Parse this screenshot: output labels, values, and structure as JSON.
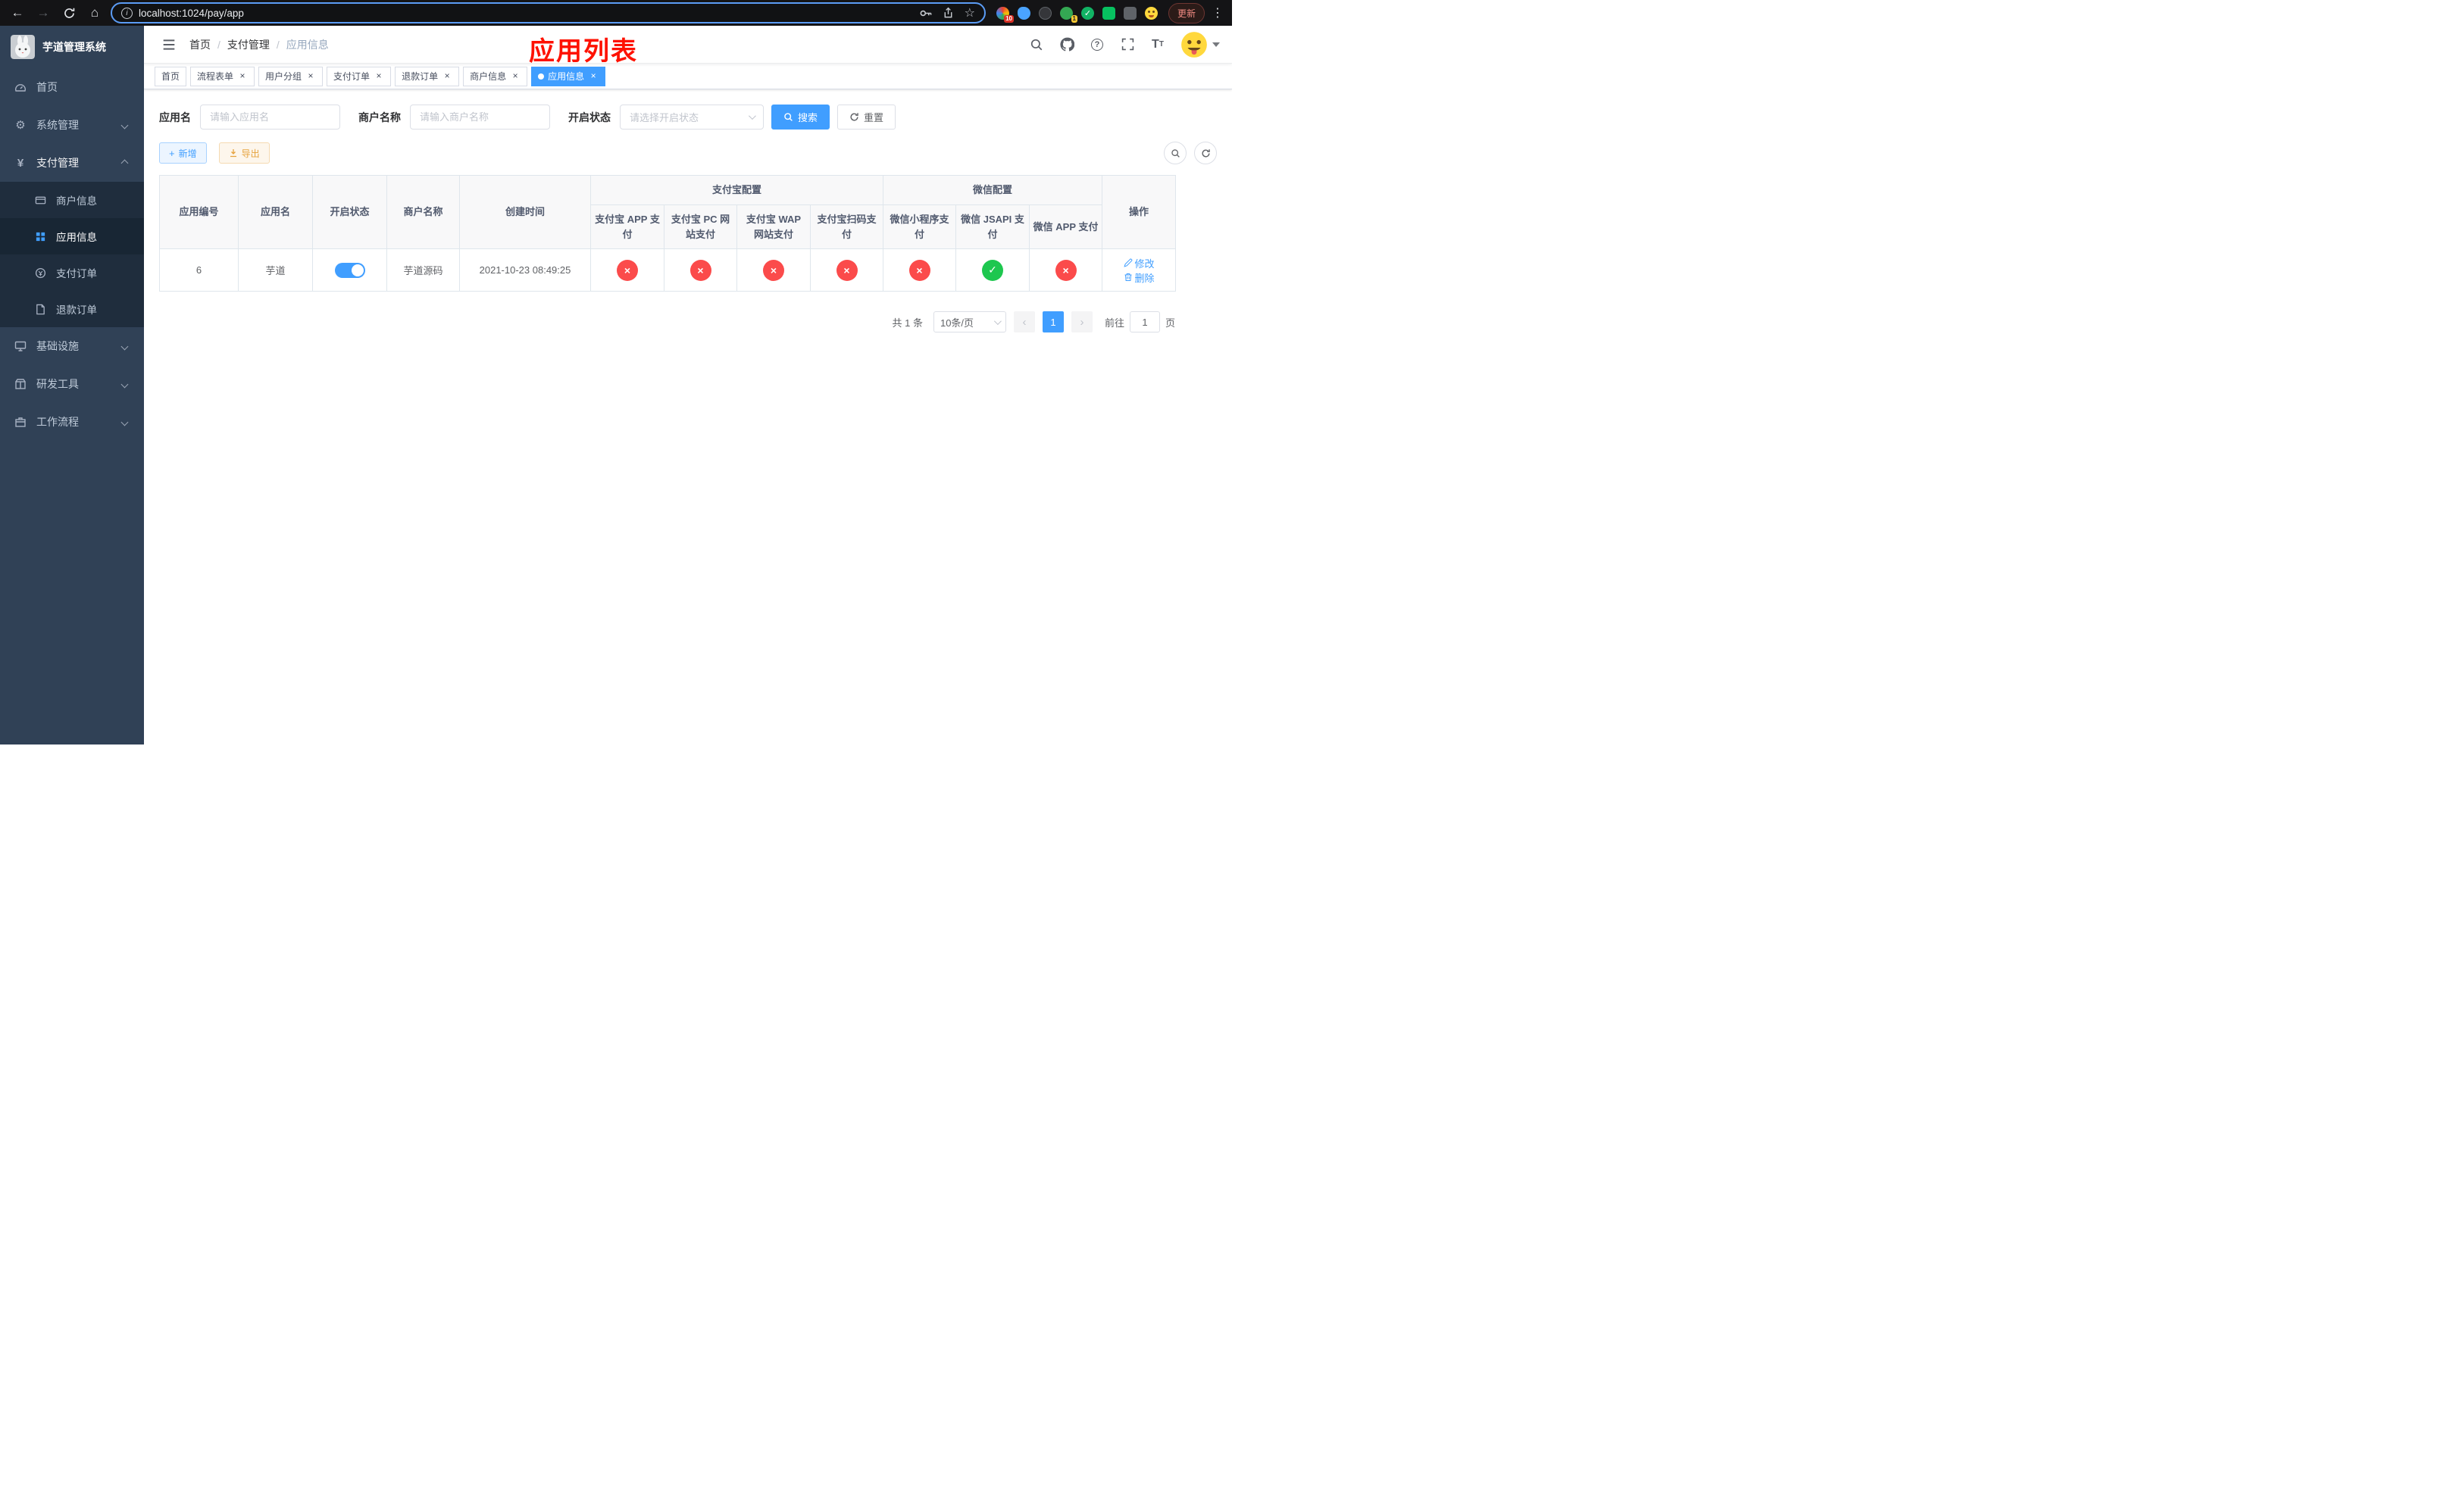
{
  "colors": {
    "primary": "#409eff",
    "success": "#1ec74f",
    "danger": "#fb4b4b",
    "warning": "#e6a23c",
    "annotation_red": "#fe1100"
  },
  "browser": {
    "url": "localhost:1024/pay/app",
    "update_label": "更新",
    "extension_badges": {
      "puzzle": "10",
      "translate": "1"
    }
  },
  "sidebar": {
    "app_title": "芋道管理系统",
    "menu": [
      {
        "label": "首页"
      },
      {
        "label": "系统管理"
      },
      {
        "label": "支付管理"
      },
      {
        "label": "基础设施"
      },
      {
        "label": "研发工具"
      },
      {
        "label": "工作流程"
      }
    ],
    "payment_submenu": [
      {
        "label": "商户信息"
      },
      {
        "label": "应用信息"
      },
      {
        "label": "支付订单"
      },
      {
        "label": "退款订单"
      }
    ]
  },
  "header": {
    "breadcrumb": [
      "首页",
      "支付管理",
      "应用信息"
    ],
    "annotation_title": "应用列表"
  },
  "tabs": [
    {
      "label": "首页"
    },
    {
      "label": "流程表单"
    },
    {
      "label": "用户分组"
    },
    {
      "label": "支付订单"
    },
    {
      "label": "退款订单"
    },
    {
      "label": "商户信息"
    },
    {
      "label": "应用信息"
    }
  ],
  "filters": {
    "app_name": {
      "label": "应用名",
      "placeholder": "请输入应用名",
      "value": ""
    },
    "merchant_name": {
      "label": "商户名称",
      "placeholder": "请输入商户名称",
      "value": ""
    },
    "status": {
      "label": "开启状态",
      "placeholder": "请选择开启状态"
    },
    "search_button": "搜索",
    "reset_button": "重置"
  },
  "toolbar": {
    "add_button": "新增",
    "export_button": "导出"
  },
  "table": {
    "groups": {
      "alipay": "支付宝配置",
      "wechat": "微信配置"
    },
    "columns": [
      "应用编号",
      "应用名",
      "开启状态",
      "商户名称",
      "创建时间",
      "支付宝 APP 支付",
      "支付宝 PC 网站支付",
      "支付宝 WAP 网站支付",
      "支付宝扫码支付",
      "微信小程序支付",
      "微信 JSAPI 支付",
      "微信 APP 支付",
      "操作"
    ],
    "rows": [
      {
        "id": "6",
        "name": "芋道",
        "enabled": true,
        "merchant": "芋道源码",
        "created_at": "2021-10-23 08:49:25",
        "configs": {
          "alipay_app": false,
          "alipay_pc": false,
          "alipay_wap": false,
          "alipay_qr": false,
          "wechat_mini": false,
          "wechat_jsapi": true,
          "wechat_app": false
        },
        "actions": {
          "edit": "修改",
          "delete": "删除"
        }
      }
    ]
  },
  "pagination": {
    "total_text": "共 1 条",
    "page_size_text": "10条/页",
    "current_page": "1",
    "goto_prefix": "前往",
    "goto_value": "1",
    "goto_suffix": "页"
  }
}
